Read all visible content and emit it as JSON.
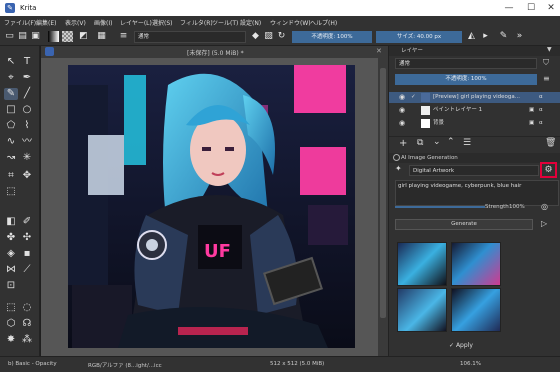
{
  "app": {
    "title": "Krita",
    "logo_glyph": "✎"
  },
  "window_controls": {
    "minimize": "—",
    "maximize": "☐",
    "close": "✕"
  },
  "menu": [
    "ファイル(F)",
    "編集(E)",
    "表示(V)",
    "画像(I)",
    "レイヤー(L)",
    "選択(S)",
    "フィルタ(R)",
    "ツール(T)",
    "設定(N)",
    "ウィンドウ(W)",
    "ヘルプ(H)"
  ],
  "toolbar": {
    "blend_mode": "通常",
    "opacity": "不透明度: 100%",
    "size": "サイズ: 40.00 px"
  },
  "document": {
    "tab_title": "[未保存]  (5.0 MiB) *"
  },
  "layers": {
    "header": "レイヤー",
    "blend": "通常",
    "opacity": "不透明度: 100%",
    "items": [
      {
        "name": "[Preview] girl playing videoga..."
      },
      {
        "name": "ペイントレイヤー 1"
      },
      {
        "name": "背景"
      }
    ]
  },
  "ai": {
    "header": "AI Image Generation",
    "style": "Digital Artwork",
    "prompt": "girl playing videogame, cyberpunk, blue hair",
    "strength_label": "Strength",
    "strength_value": "100%",
    "generate": "Generate",
    "apply": "Apply"
  },
  "status": {
    "left": "b) Basic - Opacity",
    "color": "RGB/アルファ (8...ight/...icc",
    "dims": "512 x 512 (5.0 MiB)",
    "zoom": "106.1%"
  },
  "colors": {
    "accent": "#3d6a99",
    "highlight": "#e3003a"
  }
}
